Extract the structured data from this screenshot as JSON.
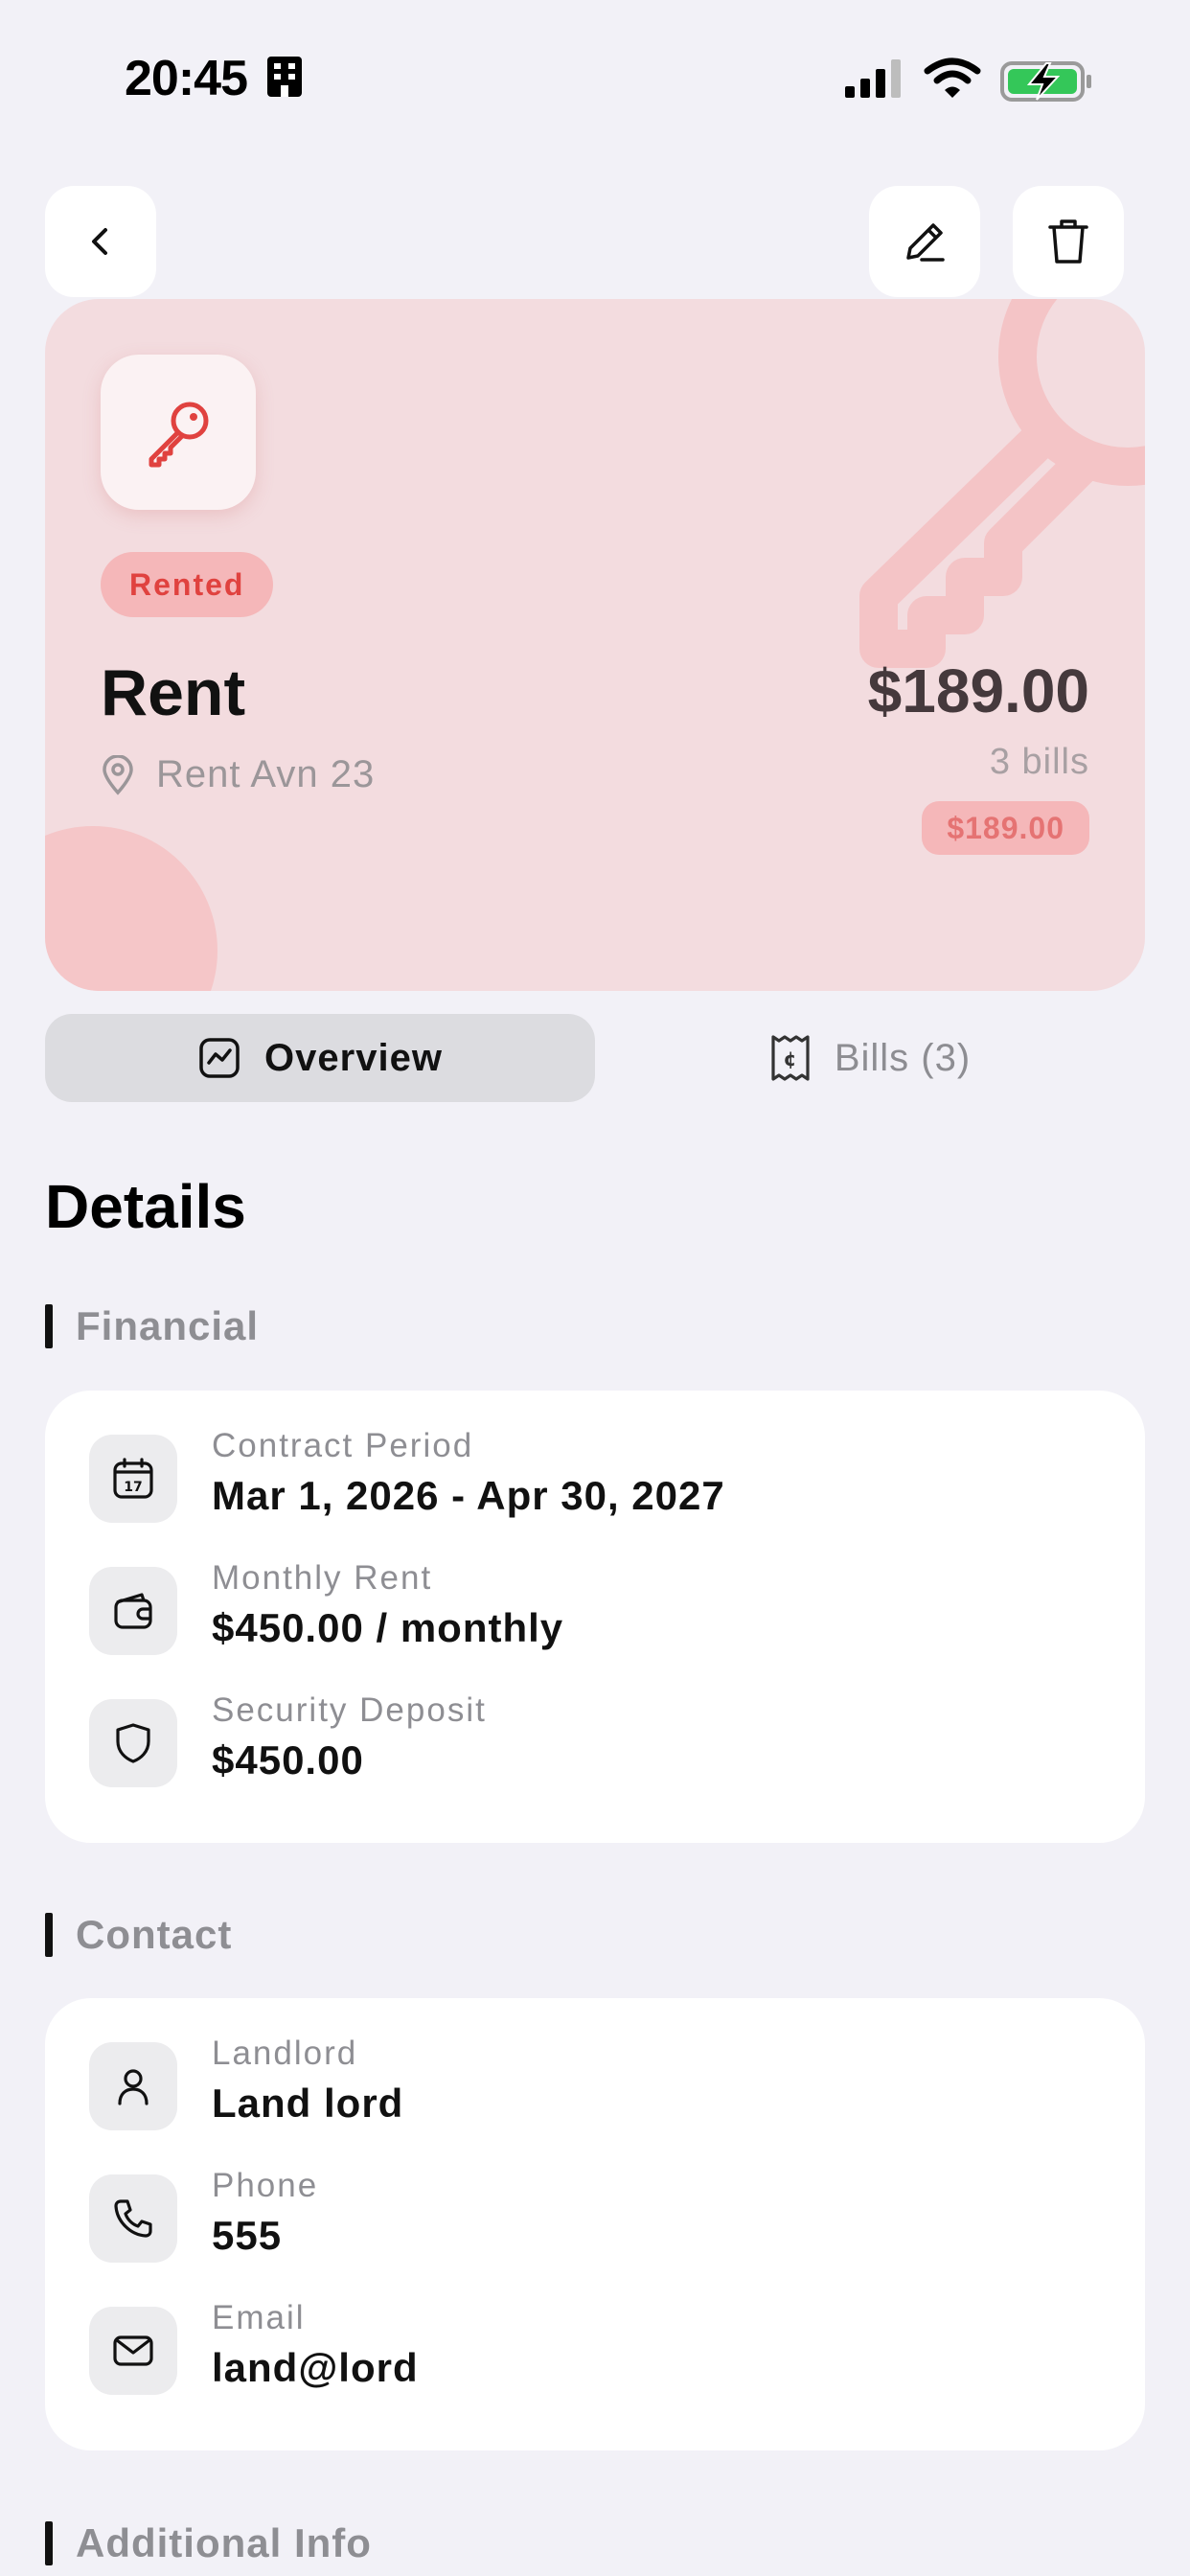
{
  "status_bar": {
    "time": "20:45"
  },
  "hero": {
    "status": "Rented",
    "title": "Rent",
    "address": "Rent Avn 23",
    "amount": "$189.00",
    "bills_count": "3 bills",
    "badge_amount": "$189.00",
    "accent_color": "#e0423f",
    "background_color": "#f3dcdf"
  },
  "tabs": [
    {
      "label": "Overview",
      "icon": "chart-line-icon",
      "active": true
    },
    {
      "label": "Bills (3)",
      "icon": "receipt-icon",
      "active": false
    }
  ],
  "page": {
    "heading": "Details"
  },
  "sections": {
    "financial": {
      "title": "Financial",
      "rows": [
        {
          "icon": "calendar-icon",
          "label": "Contract Period",
          "value": "Mar 1, 2026 - Apr 30, 2027"
        },
        {
          "icon": "wallet-icon",
          "label": "Monthly Rent",
          "value": "$450.00 / monthly"
        },
        {
          "icon": "shield-icon",
          "label": "Security Deposit",
          "value": "$450.00"
        }
      ]
    },
    "contact": {
      "title": "Contact",
      "rows": [
        {
          "icon": "person-icon",
          "label": "Landlord",
          "value": "Land lord"
        },
        {
          "icon": "phone-icon",
          "label": "Phone",
          "value": "555"
        },
        {
          "icon": "envelope-icon",
          "label": "Email",
          "value": "land@lord"
        }
      ]
    },
    "additional": {
      "title": "Additional Info"
    }
  }
}
